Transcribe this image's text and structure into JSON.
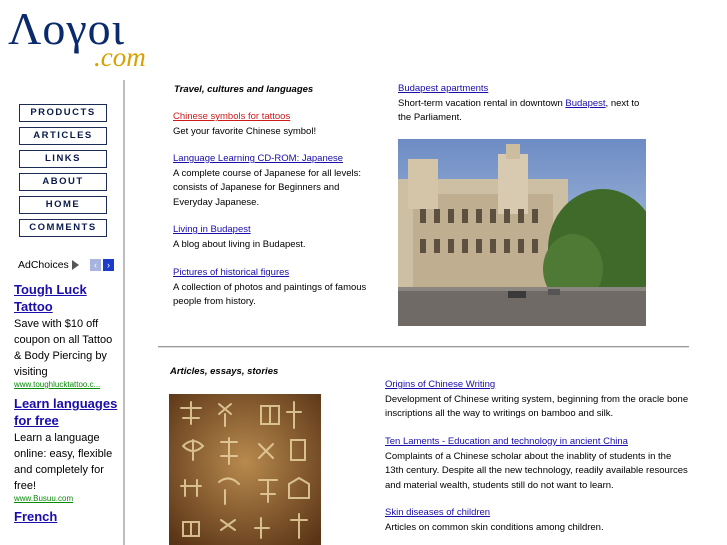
{
  "logo": {
    "main": "Λογοι",
    "sub": ".com"
  },
  "nav": [
    "PRODUCTS",
    "ARTICLES",
    "LINKS",
    "ABOUT",
    "HOME",
    "COMMENTS"
  ],
  "adchoices": {
    "label": "AdChoices",
    "prev": "‹",
    "next": "›"
  },
  "ads": [
    {
      "title": "Tough Luck Tattoo",
      "text": "Save with $10 off coupon on all Tattoo & Body Piercing by visiting",
      "url": "www.toughlucktattoo.c..."
    },
    {
      "title": "Learn languages for free",
      "text": "Learn a language online: easy, flexible and completely for free!",
      "url": "www.Busuu.com"
    },
    {
      "title": "French",
      "text": "",
      "url": ""
    }
  ],
  "section1": {
    "title": "Travel, cultures and languages",
    "items": [
      {
        "link": "Chinese symbols for tattoos",
        "desc": "Get your favorite Chinese symbol!"
      },
      {
        "link": "Language Learning CD-ROM: Japanese",
        "desc": "A complete course of Japanese for all levels: consists of Japanese for Beginners and Everyday Japanese."
      },
      {
        "link": "Living in Budapest",
        "desc": "A blog about living in Budapest."
      },
      {
        "link": "Pictures of historical figures",
        "desc": "A collection of photos and paintings of famous people from history."
      }
    ],
    "right": {
      "link": "Budapest apartments",
      "desc_before": "Short-term vacation rental in downtown ",
      "desc_link": "Budapest",
      "desc_after": ", next to the Parliament."
    }
  },
  "section2": {
    "title": "Articles, essays, stories",
    "items": [
      {
        "link": "Origins of Chinese Writing",
        "desc": "Development of Chinese writing system, beginning from the oracle bone inscriptions all the way to writings on bamboo and silk."
      },
      {
        "link": "Ten Laments - Education and technology in ancient China",
        "desc": "Complaints of a Chinese scholar about the inablity of students in the 13th century. Despite all the new technology, readily available resources and material wealth, students still do not want to learn."
      },
      {
        "link": "Skin diseases of children",
        "desc": "Articles on common skin conditions among children."
      }
    ]
  },
  "colors": {
    "link": "#1a0dab",
    "highlight_link": "#cc1a1a",
    "logo": "#0b2a6e",
    "logo_accent": "#d8a100",
    "ad_url": "#0a8a0a"
  }
}
